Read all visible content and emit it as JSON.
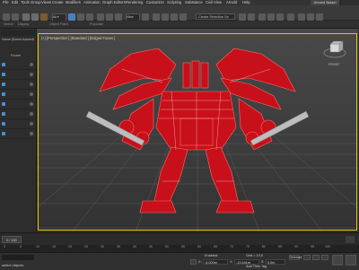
{
  "menubar": {
    "items": [
      "File",
      "Edit",
      "Tools",
      "Group",
      "Views",
      "Create",
      "Modifiers",
      "Animation",
      "Graph Editors",
      "Rendering",
      "Customize",
      "Scripting",
      "Substance",
      "Civil View",
      "Arnold",
      "Help"
    ],
    "user": "Ahmed Baiaei"
  },
  "toolbar": {
    "view_dropdown": "View",
    "selection_set": "Create Selection Se"
  },
  "ribbon": {
    "tabs": [
      "Select",
      "Display",
      "Object Paint",
      "Populate"
    ]
  },
  "scene_explorer": {
    "header": "Name (Sorted Ascending)",
    "sort_label": "Frozen"
  },
  "viewport": {
    "label": "[+] [Perspective ] [Standard ] [Edged Faces ]",
    "viewcube_label": "FRONT",
    "colors": {
      "model": "#cc1111",
      "selection_border": "#e6c300",
      "grid": "#5a5a5a"
    }
  },
  "timeline": {
    "frame_display": "0 / 100",
    "ticks": [
      "0",
      "5",
      "10",
      "15",
      "20",
      "25",
      "30",
      "35",
      "40",
      "45",
      "50",
      "55",
      "60",
      "65",
      "70",
      "75",
      "80",
      "85",
      "90",
      "95",
      "100"
    ]
  },
  "statusbar": {
    "message": "select objects",
    "x_label": "X:",
    "x_value": "-5,000m",
    "y_label": "Y:",
    "y_value": "-13.441m",
    "z_label": "Z:",
    "z_value": "0,0m",
    "grid_label": "Grid = 10,0",
    "selection_lock": "Selected",
    "add_time_tag": "Add Time Tag",
    "enabled_label": "Enabled:"
  }
}
